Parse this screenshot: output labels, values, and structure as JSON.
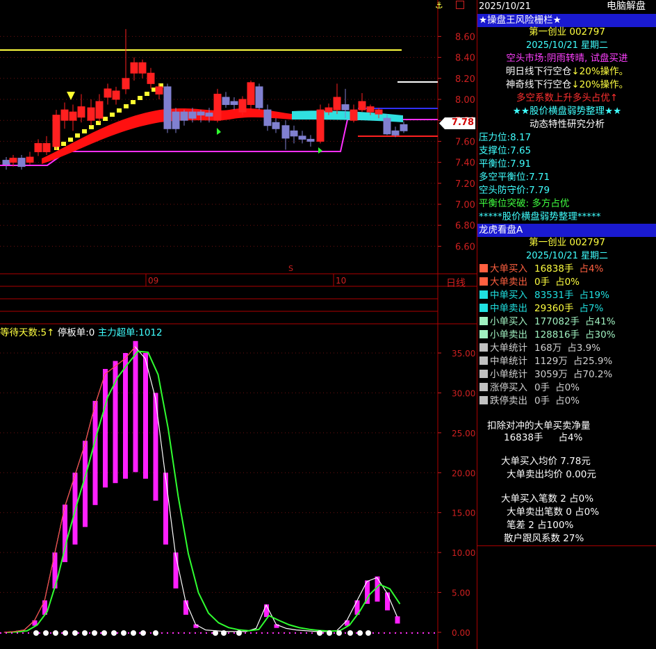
{
  "top_bar": {
    "date": "2025/10/21",
    "mode": "电脑解盘",
    "anchor_icon": "anchor-icon",
    "lock_icon": "lock-icon"
  },
  "upper_chart": {
    "y_ticks": [
      "8.60",
      "8.40",
      "8.20",
      "8.00",
      "7.80",
      "7.60",
      "7.40",
      "7.20",
      "7.00",
      "6.80",
      "6.60"
    ],
    "current_price": "7.78",
    "x_labels": [
      "09",
      "10"
    ],
    "s_marker": "S",
    "period_label": "日线"
  },
  "lower_chart": {
    "legend": [
      {
        "text": "等待天数:5",
        "color": "#ffff40"
      },
      {
        "text": "↑",
        "color": "#ffff40"
      },
      {
        "text": "停板单:0",
        "color": "#ffffff"
      },
      {
        "text": "主力超单:1012",
        "color": "#40ffff"
      }
    ],
    "y_ticks": [
      "35.00",
      "30.00",
      "25.00",
      "20.00",
      "15.00",
      "10.00",
      "5.00",
      "0.00"
    ]
  },
  "chart_data": {
    "type": "bar",
    "title": "",
    "ylim": [
      0,
      37
    ],
    "series": [
      {
        "name": "",
        "values": [
          0,
          0.1,
          0.3,
          1.5,
          4,
          10,
          16,
          20,
          24,
          29,
          33,
          34,
          35,
          36.5,
          35,
          30,
          20,
          10,
          4,
          1,
          0.3,
          0.2,
          0.1,
          0.1,
          0.1,
          0.5,
          3.5,
          1,
          0.5,
          0.3,
          0.2,
          0.1,
          0.1,
          0.2,
          1.5,
          4,
          6.5,
          7,
          5,
          2
        ]
      }
    ]
  },
  "panel1": {
    "title": "★操盘王风险栅栏★",
    "stock": "第一创业   002797",
    "date": "2025/10/21     星期二",
    "line1": "空头市场:阴雨转晴, 试盘买进",
    "line2_a": "明日线下行空仓",
    "line2_b": "↓20%操作。",
    "line3_a": "神奇线下行空仓",
    "line3_b": "↓20%操作。",
    "line4": "多空系数上升多头占优↑",
    "line5_a": "★★",
    "line5_b": "股价横盘弱势整理",
    "line5_c": "★★",
    "line6": "动态特性研究分析",
    "stats": [
      {
        "label": "压力位:",
        "value": "8.17",
        "color": "#40ffff"
      },
      {
        "label": "支撑位:",
        "value": "7.65",
        "color": "#40ffff"
      },
      {
        "label": "平衡位:",
        "value": "7.91",
        "color": "#40ffff"
      },
      {
        "label": "多空平衡位:",
        "value": "7.71",
        "color": "#40ffff"
      },
      {
        "label": "空头防守价:",
        "value": "7.79",
        "color": "#40ffff"
      }
    ],
    "breakthrough": "平衡位突破: 多方占优",
    "footer": "*****股价横盘弱势整理*****"
  },
  "panel2": {
    "title": "龙虎看盘A",
    "stock": "第一创业   002797",
    "date": "2025/10/21     星期二",
    "rows": [
      {
        "label": "大单买入",
        "val": "16838手",
        "pct": "占4%",
        "sq": "#ff6040",
        "color": "#ff6040",
        "valcolor": "#ffff40",
        "pctcolor": "#ff6040"
      },
      {
        "label": "大单卖出",
        "val": "0手",
        "pct": "占0%",
        "sq": "#ff6040",
        "color": "#ff6040",
        "valcolor": "#ffff40",
        "pctcolor": "#ffff40"
      },
      {
        "label": "中单买入",
        "val": "83531手",
        "pct": "占19%",
        "sq": "#20e0e0",
        "color": "#20e0e0",
        "valcolor": "#20e0e0",
        "pctcolor": "#20e0e0"
      },
      {
        "label": "中单卖出",
        "val": "29360手",
        "pct": "占7%",
        "sq": "#20e0e0",
        "color": "#20e0e0",
        "valcolor": "#ffff40",
        "pctcolor": "#20e0e0"
      },
      {
        "label": "小单买入",
        "val": "177082手",
        "pct": "占41%",
        "sq": "#a0f0c0",
        "color": "#a0f0c0",
        "valcolor": "#a0f0c0",
        "pctcolor": "#a0f0c0"
      },
      {
        "label": "小单卖出",
        "val": "128816手",
        "pct": "占30%",
        "sq": "#a0f0c0",
        "color": "#a0f0c0",
        "valcolor": "#a0f0c0",
        "pctcolor": "#a0f0c0"
      },
      {
        "label": "大单统计",
        "val": "168万",
        "pct": "占3.9%",
        "sq": "#c0c0c0",
        "color": "#d0d0d0",
        "valcolor": "#d0d0d0",
        "pctcolor": "#d0d0d0"
      },
      {
        "label": "中单统计",
        "val": "1129万",
        "pct": "占25.9%",
        "sq": "#c0c0c0",
        "color": "#d0d0d0",
        "valcolor": "#d0d0d0",
        "pctcolor": "#d0d0d0"
      },
      {
        "label": "小单统计",
        "val": "3059万",
        "pct": "占70.2%",
        "sq": "#c0c0c0",
        "color": "#d0d0d0",
        "valcolor": "#d0d0d0",
        "pctcolor": "#d0d0d0"
      },
      {
        "label": "涨停买入",
        "val": "0手",
        "pct": "占0%",
        "sq": "#c0c0c0",
        "color": "#d0d0d0",
        "valcolor": "#d0d0d0",
        "pctcolor": "#d0d0d0"
      },
      {
        "label": "跌停卖出",
        "val": "0手",
        "pct": "占0%",
        "sq": "#c0c0c0",
        "color": "#d0d0d0",
        "valcolor": "#d0d0d0",
        "pctcolor": "#d0d0d0"
      }
    ],
    "net_title": "扣除对冲的大单买卖净量",
    "net_value": "16838手",
    "net_pct": "占4%",
    "avg_buy": "大单买入均价   7.78元",
    "avg_sell": "大单卖出均价   0.00元",
    "cnt_buy": "大单买入笔数  2   占0%",
    "cnt_sell": "大单卖出笔数  0   占0%",
    "cnt_diff": "笔差        2          占100%",
    "retail": "散户跟风系数      27%"
  }
}
